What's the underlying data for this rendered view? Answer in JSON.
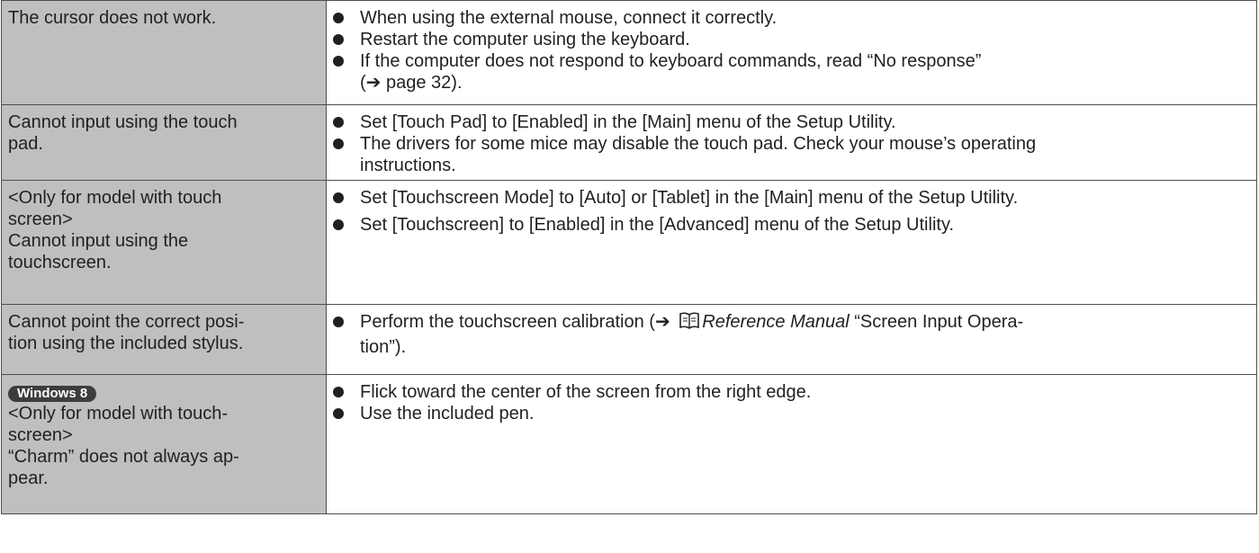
{
  "rows": [
    {
      "problem_lines": [
        "The cursor does not work."
      ],
      "solutions": [
        "When using the external mouse, connect it correctly.",
        "Restart the computer using the keyboard.",
        "If the computer does not respond to keyboard commands, read “No response”"
      ],
      "solution3_line2_prefix": "(",
      "solution3_line2_arrow": "➔",
      "solution3_line2_suffix": " page 32)."
    },
    {
      "problem_lines": [
        "Cannot input using the touch",
        "pad."
      ],
      "solutions": [
        "Set [Touch Pad] to [Enabled] in the [Main] menu of the Setup Utility.",
        "The drivers for some mice may disable the touch pad. Check your mouse’s operating",
        "instructions."
      ]
    },
    {
      "problem_lines": [
        "<Only for model with touch",
        "screen>",
        "Cannot input using the",
        "touchscreen."
      ],
      "solutions": [
        "Set [Touchscreen Mode] to [Auto] or [Tablet] in the [Main] menu of the Setup Utility.",
        "Set [Touchscreen] to [Enabled] in the [Advanced] menu of the Setup Utility."
      ]
    },
    {
      "problem_lines": [
        "Cannot point the correct posi-",
        "tion using the included stylus."
      ],
      "solution_prefix": "Perform the touchscreen calibration (",
      "solution_arrow": "➔",
      "solution_manual": "Reference Manual",
      "solution_suffix": " “Screen Input Opera-",
      "solution_line2": "tion”)."
    },
    {
      "badge": "Windows 8",
      "problem_lines": [
        "<Only for model with touch-",
        "screen>",
        "“Charm” does not always ap-",
        "pear."
      ],
      "solutions": [
        "Flick toward the center of the screen from the right edge.",
        "Use the included pen."
      ]
    }
  ]
}
